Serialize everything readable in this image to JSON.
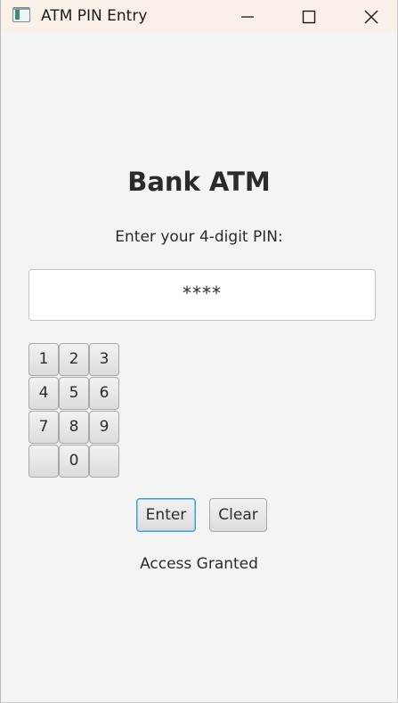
{
  "window": {
    "title": "ATM PIN Entry",
    "app_icon": "java-app-icon",
    "controls": [
      "minimize-icon",
      "maximize-icon",
      "close-icon"
    ]
  },
  "main": {
    "heading": "Bank ATM",
    "prompt": "Enter your 4-digit PIN:",
    "pin_field_value": "****"
  },
  "keypad": {
    "keys": [
      "1",
      "2",
      "3",
      "4",
      "5",
      "6",
      "7",
      "8",
      "9",
      "",
      "0",
      ""
    ]
  },
  "actions": {
    "enter_label": "Enter",
    "clear_label": "Clear"
  },
  "status": {
    "message": "Access Granted"
  },
  "colors": {
    "titlebar": "#f9f1e8",
    "background": "#f4f4f4",
    "focus_border": "#3d9ed8"
  }
}
